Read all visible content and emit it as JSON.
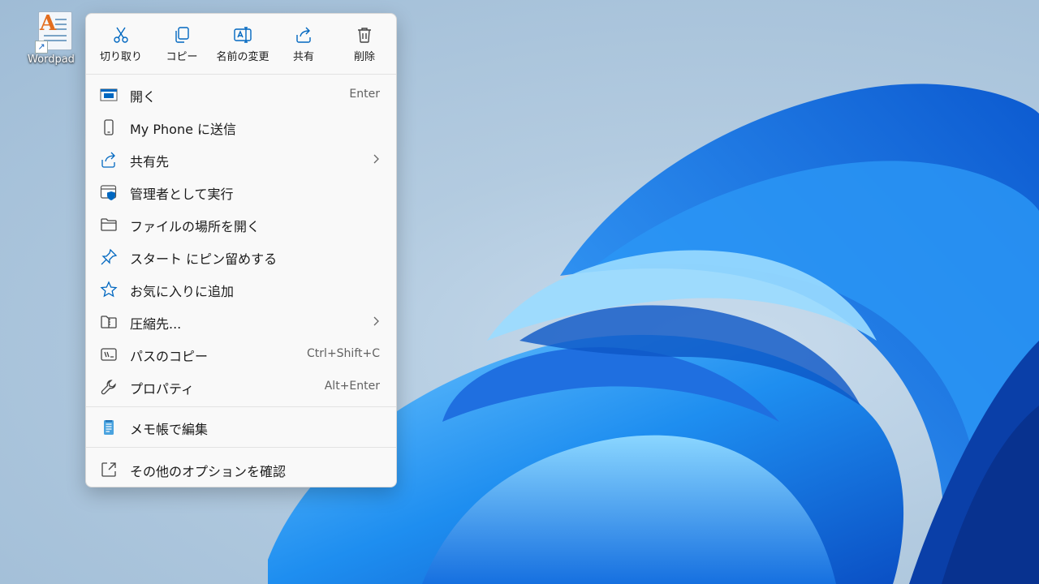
{
  "desktop": {
    "icon_label": "Wordpad",
    "icon_letter": "A"
  },
  "quick_actions": [
    {
      "label": "切り取り",
      "icon": "scissors-icon"
    },
    {
      "label": "コピー",
      "icon": "copy-icon"
    },
    {
      "label": "名前の変更",
      "icon": "rename-icon"
    },
    {
      "label": "共有",
      "icon": "share-icon"
    },
    {
      "label": "削除",
      "icon": "trash-icon"
    }
  ],
  "menu_items": [
    {
      "label": "開く",
      "shortcut": "Enter",
      "icon": "open-app-icon"
    },
    {
      "label": "My Phone に送信",
      "icon": "phone-icon"
    },
    {
      "label": "共有先",
      "icon": "share-to-icon",
      "submenu": true
    },
    {
      "label": "管理者として実行",
      "icon": "admin-shield-icon"
    },
    {
      "label": "ファイルの場所を開く",
      "icon": "folder-icon"
    },
    {
      "label": "スタート にピン留めする",
      "icon": "pin-icon"
    },
    {
      "label": "お気に入りに追加",
      "icon": "star-icon"
    },
    {
      "label": "圧縮先...",
      "icon": "zip-folder-icon",
      "submenu": true
    },
    {
      "label": "パスのコピー",
      "shortcut": "Ctrl+Shift+C",
      "icon": "copy-path-icon"
    },
    {
      "label": "プロパティ",
      "shortcut": "Alt+Enter",
      "icon": "wrench-icon"
    },
    {
      "label": "メモ帳で編集",
      "icon": "notepad-icon"
    },
    {
      "label": "その他のオプションを確認",
      "icon": "more-options-icon"
    }
  ],
  "colors": {
    "accent": "#0067c0",
    "wallpaper_blue": "#1a7fe8"
  }
}
